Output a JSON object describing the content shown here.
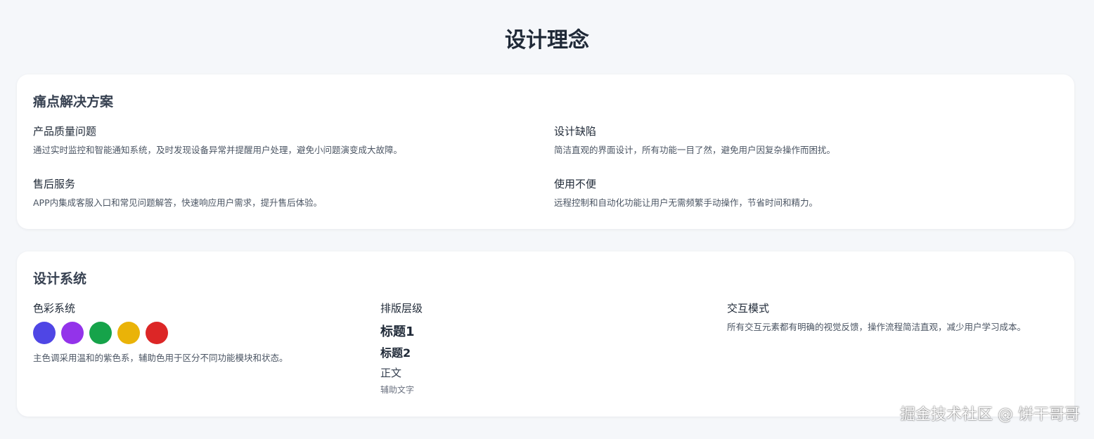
{
  "page": {
    "title": "设计理念"
  },
  "pain_points": {
    "title": "痛点解决方案",
    "items": [
      {
        "title": "产品质量问题",
        "desc": "通过实时监控和智能通知系统，及时发现设备异常并提醒用户处理，避免小问题演变成大故障。"
      },
      {
        "title": "设计缺陷",
        "desc": "简洁直观的界面设计，所有功能一目了然，避免用户因复杂操作而困扰。"
      },
      {
        "title": "售后服务",
        "desc": "APP内集成客服入口和常见问题解答，快速响应用户需求，提升售后体验。"
      },
      {
        "title": "使用不便",
        "desc": "远程控制和自动化功能让用户无需频繁手动操作，节省时间和精力。"
      }
    ]
  },
  "design_system": {
    "title": "设计系统",
    "colors": {
      "title": "色彩系统",
      "swatches": [
        "#4f46e5",
        "#9333ea",
        "#16a34a",
        "#eab308",
        "#dc2626"
      ],
      "desc": "主色调采用温和的紫色系，辅助色用于区分不同功能模块和状态。"
    },
    "typography": {
      "title": "排版层级",
      "h1": "标题1",
      "h2": "标题2",
      "body": "正文",
      "aux": "辅助文字"
    },
    "interaction": {
      "title": "交互模式",
      "desc": "所有交互元素都有明确的视觉反馈，操作流程简洁直观，减少用户学习成本。"
    }
  },
  "watermark": "掘金技术社区 @ 饼干哥哥"
}
